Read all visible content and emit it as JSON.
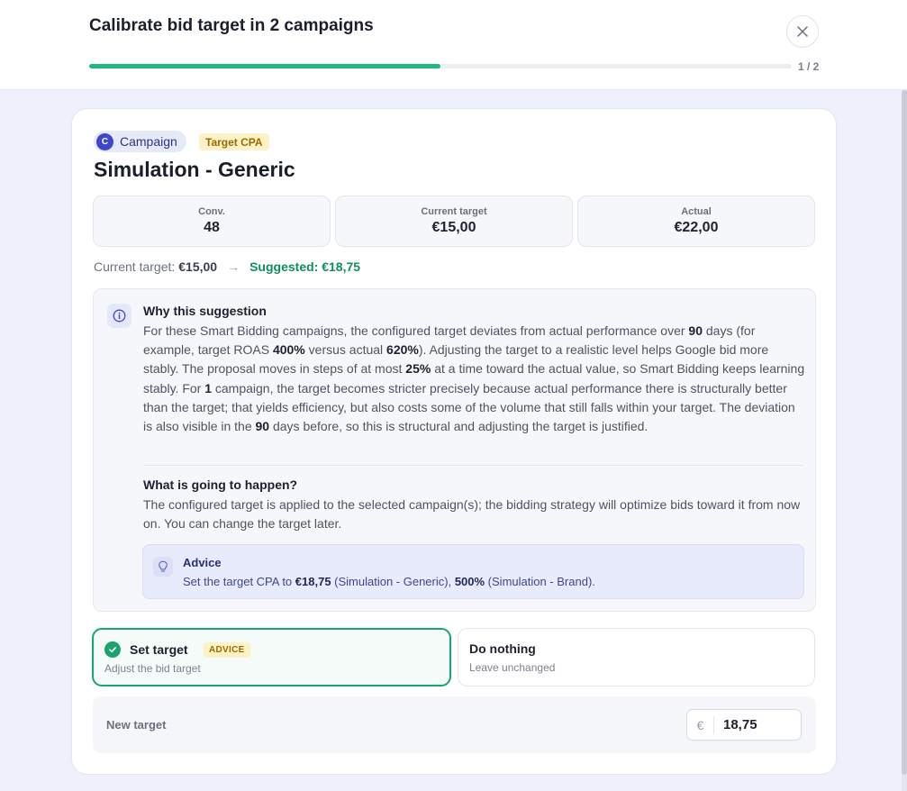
{
  "modal": {
    "title": "Calibrate bid target in 2 campaigns",
    "progress_label": "1 / 2",
    "progress_fraction": 0.5,
    "close_icon": "close-icon"
  },
  "campaign": {
    "type_label": "Campaign",
    "type_initial": "C",
    "strategy_badge": "Target CPA",
    "name": "Simulation - Generic"
  },
  "stats": [
    {
      "label": "Conv.",
      "value": "48"
    },
    {
      "label": "Current target",
      "value": "€15,00"
    },
    {
      "label": "Actual",
      "value": "€22,00"
    }
  ],
  "target_line": {
    "current_label": "Current target:",
    "current_value": "€15,00",
    "arrow": "→",
    "suggested": "Suggested: €18,75"
  },
  "why": {
    "title": "Why this suggestion",
    "body": [
      {
        "t": "For these Smart Bidding campaigns, the configured target deviates from actual performance over "
      },
      {
        "t": "90",
        "b": true
      },
      {
        "t": " days (for example, target ROAS "
      },
      {
        "t": "400%",
        "b": true
      },
      {
        "t": " versus actual "
      },
      {
        "t": "620%",
        "b": true
      },
      {
        "t": "). Adjusting the target to a realistic level helps Google bid more stably. The proposal moves in steps of at most "
      },
      {
        "t": "25%",
        "b": true
      },
      {
        "t": " at a time toward the actual value, so Smart Bidding keeps learning stably. For "
      },
      {
        "t": "1",
        "b": true
      },
      {
        "t": " campaign, the target becomes stricter precisely because actual performance there is structurally better than the target; that yields efficiency, but also costs some of the volume that still falls within your target. The deviation is also visible in the "
      },
      {
        "t": "90",
        "b": true
      },
      {
        "t": " days before, so this is structural and adjusting the target is justified."
      }
    ]
  },
  "happen": {
    "title": "What is going to happen?",
    "body": "The configured target is applied to the selected campaign(s); the bidding strategy will optimize bids toward it from now on. You can change the target later."
  },
  "advice": {
    "title": "Advice",
    "body": [
      {
        "t": "Set the target CPA to "
      },
      {
        "t": "€18,75",
        "b": true
      },
      {
        "t": " (Simulation - Generic), "
      },
      {
        "t": "500%",
        "b": true
      },
      {
        "t": " (Simulation - Brand)."
      }
    ]
  },
  "options": {
    "set": {
      "title": "Set target",
      "badge": "ADVICE",
      "subtitle": "Adjust the bid target",
      "selected": true
    },
    "none": {
      "title": "Do nothing",
      "subtitle": "Leave unchanged",
      "selected": false
    }
  },
  "new_target": {
    "label": "New target",
    "currency": "€",
    "value": "18,75"
  },
  "colors": {
    "accent_green": "#1fb87f",
    "brand_blue": "#3d48c9",
    "badge_yellow": "#fdf2c6"
  }
}
